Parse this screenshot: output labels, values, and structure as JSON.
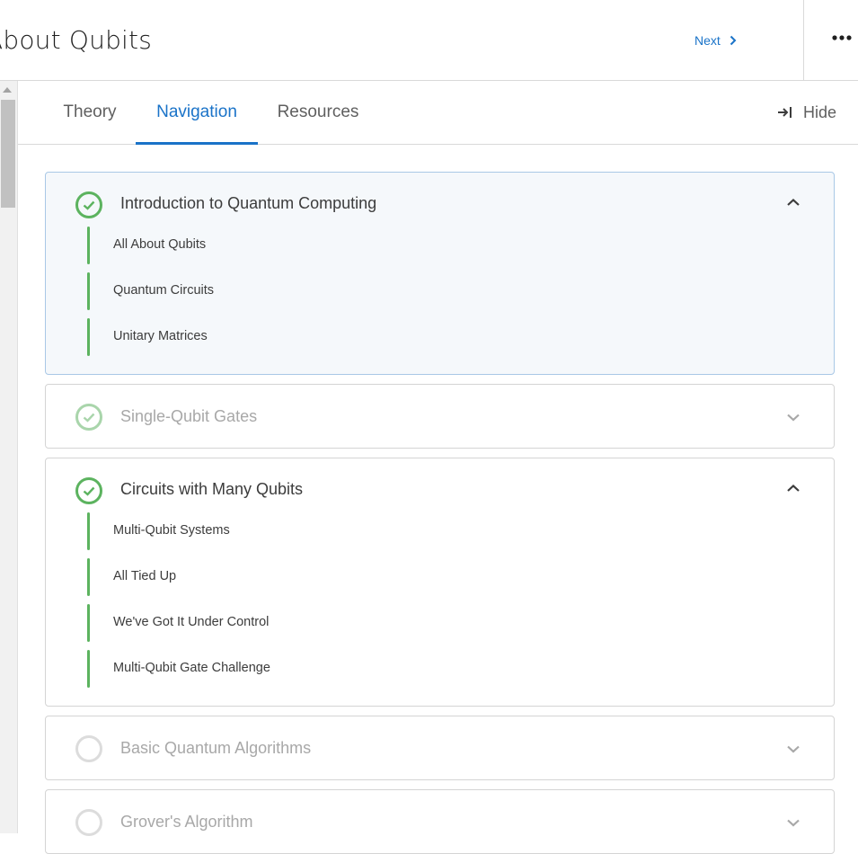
{
  "header": {
    "title": "About Qubits",
    "next_label": "Next"
  },
  "tabs": [
    {
      "label": "Theory",
      "active": false
    },
    {
      "label": "Navigation",
      "active": true
    },
    {
      "label": "Resources",
      "active": false
    }
  ],
  "hide_label": "Hide",
  "colors": {
    "accent": "#1a73c8",
    "complete_green": "#5cb35f",
    "complete_green_faded": "#a9d5ab",
    "pending_gray": "#d6d6d6"
  },
  "sections": [
    {
      "title": "Introduction to Quantum Computing",
      "status": "complete",
      "expanded": true,
      "lessons": [
        "All About Qubits",
        "Quantum Circuits",
        "Unitary Matrices"
      ]
    },
    {
      "title": "Single-Qubit Gates",
      "status": "complete",
      "expanded": false,
      "lessons": []
    },
    {
      "title": "Circuits with Many Qubits",
      "status": "complete",
      "expanded": true,
      "lessons": [
        "Multi-Qubit Systems",
        "All Tied Up",
        "We've Got It Under Control",
        "Multi-Qubit Gate Challenge"
      ]
    },
    {
      "title": "Basic Quantum Algorithms",
      "status": "not-started",
      "expanded": false,
      "lessons": []
    },
    {
      "title": "Grover's Algorithm",
      "status": "not-started",
      "expanded": false,
      "lessons": []
    }
  ]
}
